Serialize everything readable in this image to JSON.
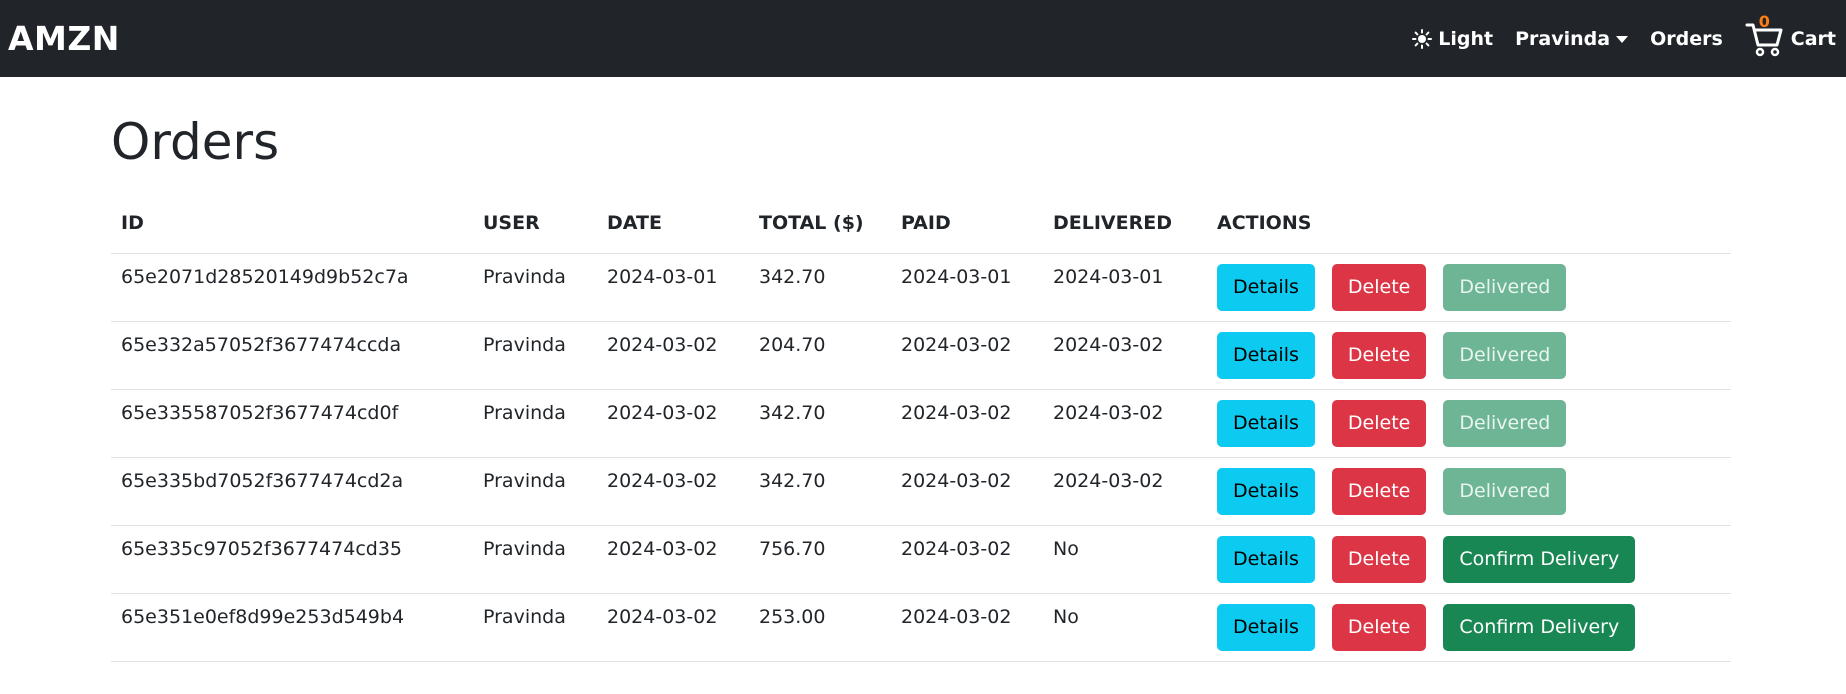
{
  "nav": {
    "brand": "AMZN",
    "theme_label": "Light",
    "user_label": "Pravinda",
    "orders_label": "Orders",
    "cart_label": "Cart",
    "cart_count": "0"
  },
  "page": {
    "title": "Orders"
  },
  "table": {
    "headers": [
      "ID",
      "USER",
      "DATE",
      "TOTAL ($)",
      "PAID",
      "DELIVERED",
      "ACTIONS"
    ],
    "details_label": "Details",
    "delete_label": "Delete",
    "rows": [
      {
        "id": "65e2071d28520149d9b52c7a",
        "user": "Pravinda",
        "date": "2024-03-01",
        "total": "342.70",
        "paid": "2024-03-01",
        "delivered": "2024-03-01",
        "delivery_action": "Delivered"
      },
      {
        "id": "65e332a57052f3677474ccda",
        "user": "Pravinda",
        "date": "2024-03-02",
        "total": "204.70",
        "paid": "2024-03-02",
        "delivered": "2024-03-02",
        "delivery_action": "Delivered"
      },
      {
        "id": "65e335587052f3677474cd0f",
        "user": "Pravinda",
        "date": "2024-03-02",
        "total": "342.70",
        "paid": "2024-03-02",
        "delivered": "2024-03-02",
        "delivery_action": "Delivered"
      },
      {
        "id": "65e335bd7052f3677474cd2a",
        "user": "Pravinda",
        "date": "2024-03-02",
        "total": "342.70",
        "paid": "2024-03-02",
        "delivered": "2024-03-02",
        "delivery_action": "Delivered"
      },
      {
        "id": "65e335c97052f3677474cd35",
        "user": "Pravinda",
        "date": "2024-03-02",
        "total": "756.70",
        "paid": "2024-03-02",
        "delivered": "No",
        "delivery_action": "Confirm Delivery"
      },
      {
        "id": "65e351e0ef8d99e253d549b4",
        "user": "Pravinda",
        "date": "2024-03-02",
        "total": "253.00",
        "paid": "2024-03-02",
        "delivered": "No",
        "delivery_action": "Confirm Delivery"
      }
    ]
  },
  "icons": {
    "theme": "sun-icon",
    "cart": "cart-icon"
  },
  "colors": {
    "navbar_bg": "#212529",
    "details": "#0dcaf0",
    "delete": "#dc3545",
    "delivered": "#6db594",
    "confirm": "#198754",
    "cart_badge": "#fd7e14"
  }
}
